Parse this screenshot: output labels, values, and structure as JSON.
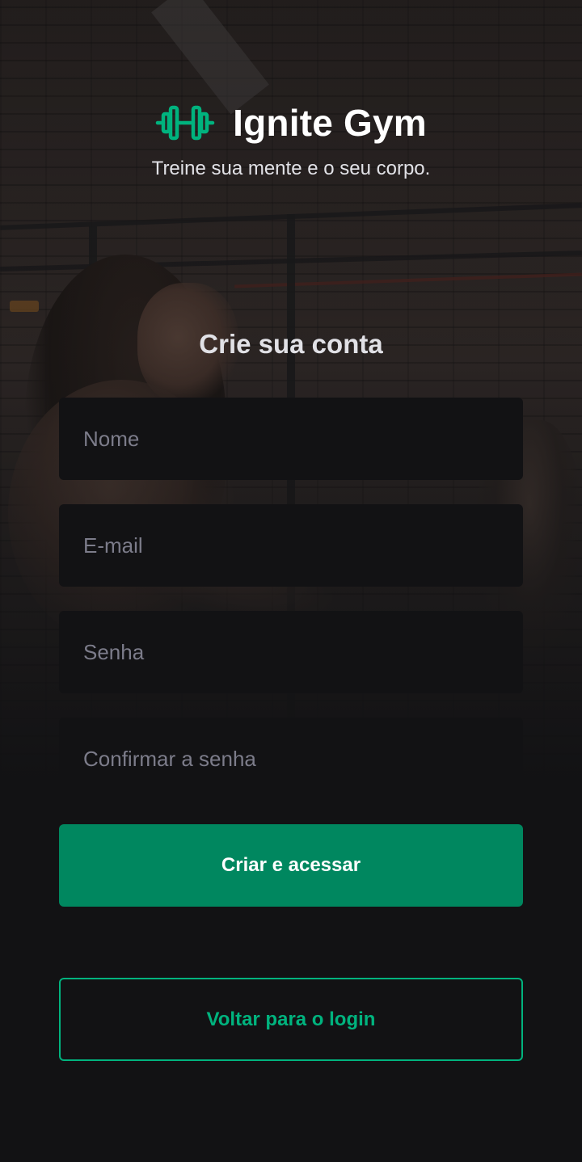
{
  "app": {
    "name": "Ignite Gym",
    "tagline": "Treine sua mente e o seu corpo.",
    "logo_icon": "dumbbell-icon",
    "background_image": "gym-photo-background"
  },
  "signup_form": {
    "title": "Crie sua conta",
    "fields": [
      {
        "placeholder": "Nome",
        "value": ""
      },
      {
        "placeholder": "E-mail",
        "value": ""
      },
      {
        "placeholder": "Senha",
        "value": ""
      },
      {
        "placeholder": "Confirmar a senha",
        "value": ""
      }
    ],
    "submit_label": "Criar e acessar",
    "back_to_login_label": "Voltar para o login"
  },
  "colors": {
    "background": "#121214",
    "input_background": "#121214",
    "placeholder": "#7c7c8a",
    "primary_button": "#00875F",
    "accent_green": "#00B37E",
    "text_light": "#E1E1E6",
    "white": "#FFFFFF"
  }
}
